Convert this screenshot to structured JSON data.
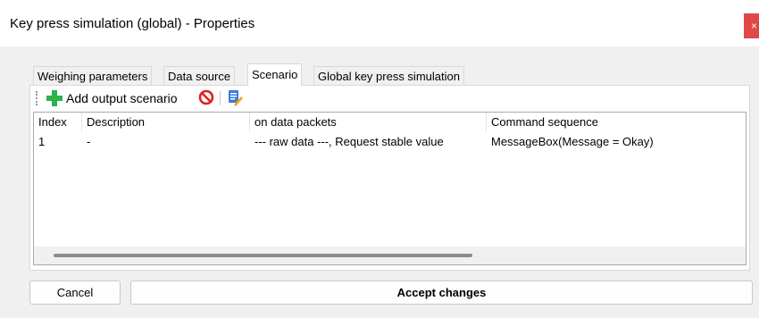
{
  "window": {
    "title": "Key press simulation (global) - Properties",
    "close_glyph": "×"
  },
  "tabs": [
    {
      "label": "Weighing parameters",
      "active": false
    },
    {
      "label": "Data source",
      "active": false
    },
    {
      "label": "Scenario",
      "active": true
    },
    {
      "label": "Global key press simulation",
      "active": false
    }
  ],
  "toolbar": {
    "add_label": "Add output scenario",
    "add_icon": "plus-icon",
    "delete_icon": "no-entry-icon",
    "edit_icon": "edit-document-icon"
  },
  "grid": {
    "columns": [
      "Index",
      "Description",
      "on data packets",
      "Command sequence"
    ],
    "rows": [
      {
        "index": "1",
        "description": "-",
        "packets": "--- raw data ---, Request stable value",
        "command": "MessageBox(Message = Okay)"
      }
    ]
  },
  "buttons": {
    "cancel": "Cancel",
    "accept": "Accept changes"
  },
  "colors": {
    "accent_green": "#2bb24c",
    "delete_red": "#e02020",
    "close_red": "#e04848"
  }
}
